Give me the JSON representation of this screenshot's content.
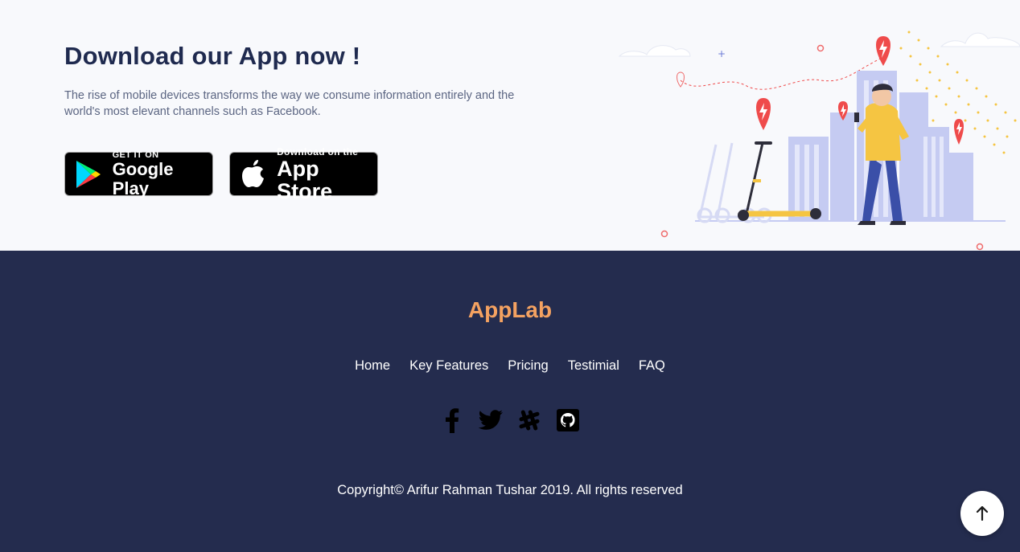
{
  "download": {
    "title": "Download our App now !",
    "description": "The rise of mobile devices transforms the way we consume information entirely and the world's most elevant channels such as Facebook.",
    "google_play": {
      "small": "GET IT ON",
      "big": "Google Play"
    },
    "app_store": {
      "small": "Download on the",
      "big": "App Store"
    }
  },
  "footer": {
    "brand": "AppLab",
    "nav": [
      "Home",
      "Key Features",
      "Pricing",
      "Testimial",
      "FAQ"
    ],
    "social_icons": [
      "facebook-icon",
      "twitter-icon",
      "slack-icon",
      "github-icon"
    ],
    "copyright": "Copyright© Arifur Rahman Tushar 2019. All rights reserved"
  },
  "colors": {
    "dark_bg": "#242c4e",
    "light_bg": "#f8f9fc",
    "brand": "#f4a261",
    "title": "#1f2a4f",
    "accent_red": "#ef4b4b",
    "accent_yellow": "#f5c542"
  }
}
